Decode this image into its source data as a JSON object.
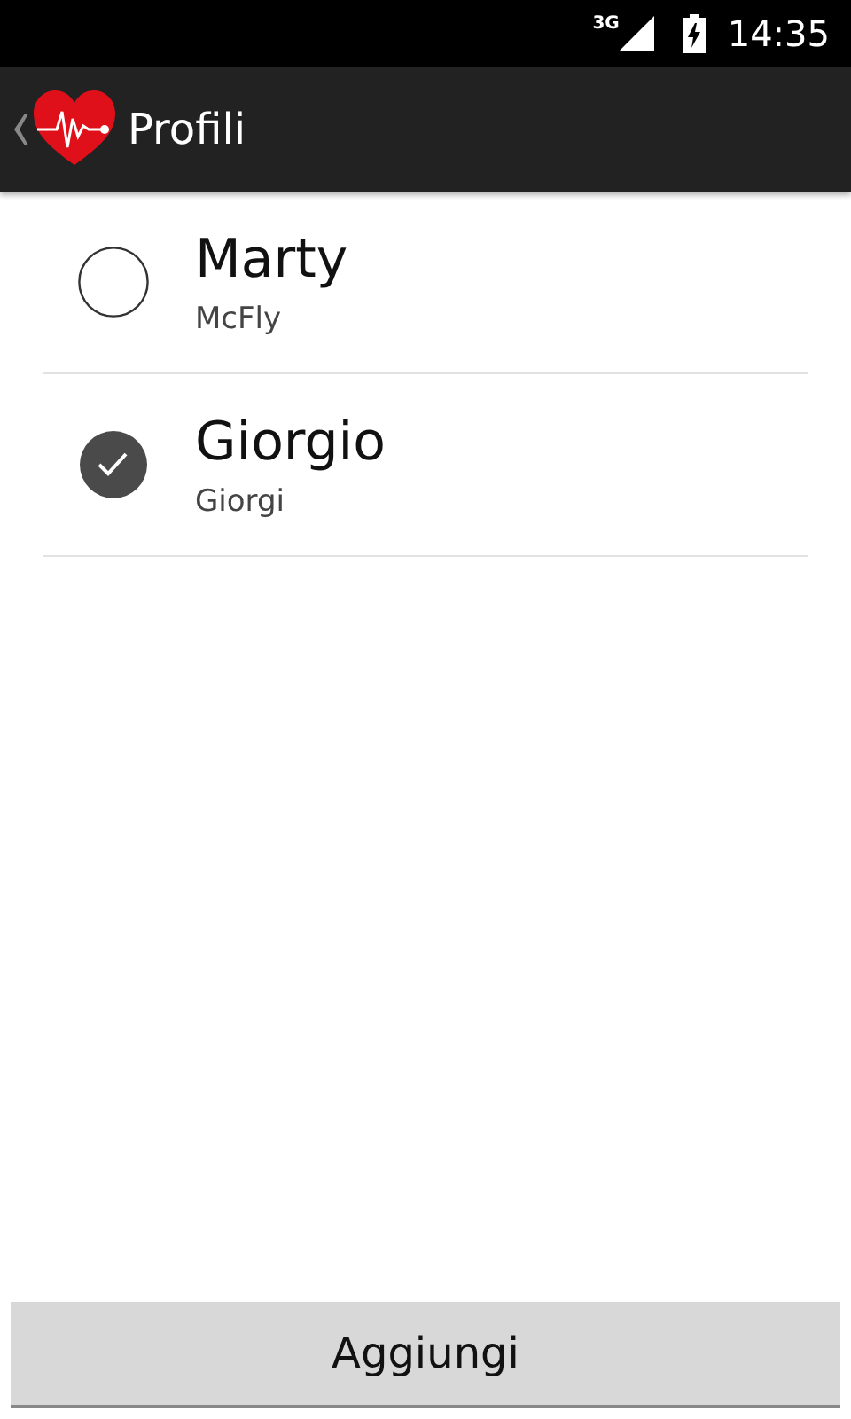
{
  "status_bar": {
    "network": "3G",
    "time": "14:35"
  },
  "action_bar": {
    "title": "Profili"
  },
  "profiles": [
    {
      "name": "Marty",
      "surname": "McFly",
      "selected": false
    },
    {
      "name": "Giorgio",
      "surname": "Giorgi",
      "selected": true
    }
  ],
  "button": "Aggiungi"
}
